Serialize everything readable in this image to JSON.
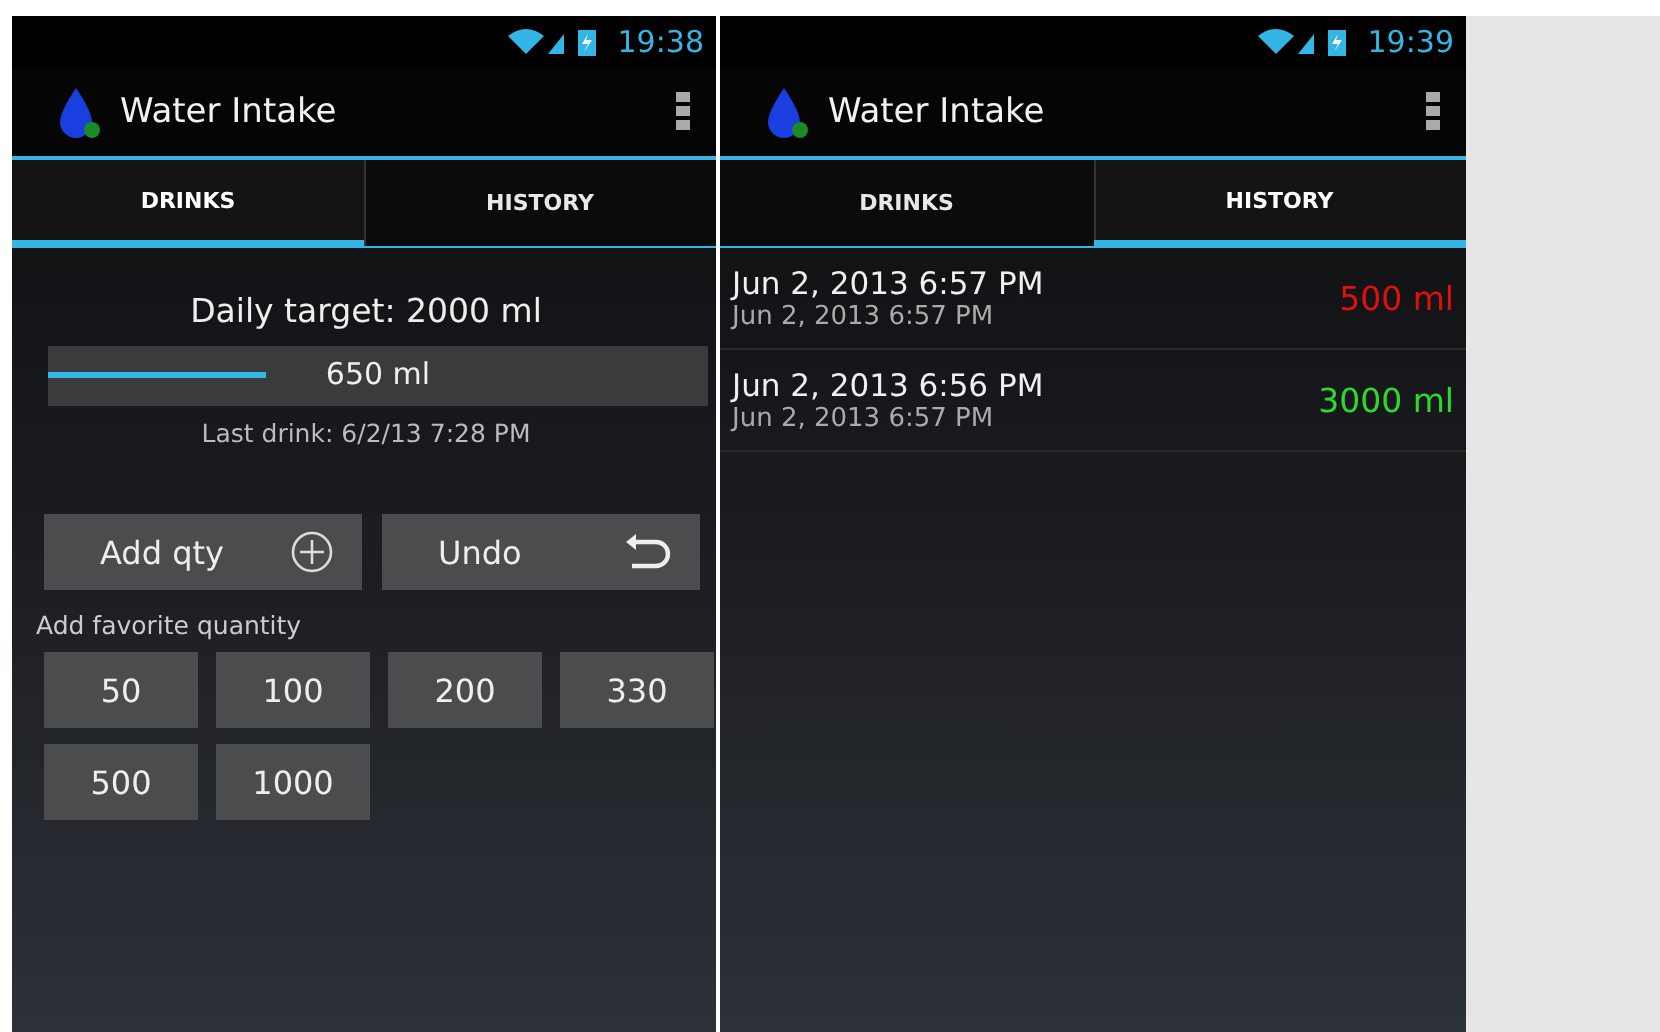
{
  "screens": [
    {
      "kind": "drinks",
      "time": "19:38",
      "app_title": "Water Intake",
      "tabs": [
        {
          "label": "DRINKS",
          "selected": true
        },
        {
          "label": "HISTORY",
          "selected": false
        }
      ],
      "daily_target": "Daily target: 2000 ml",
      "progress": {
        "level": 0.33,
        "reading": "650 ml"
      },
      "last_drink": "Last drink: 6/2/13 7:28 PM",
      "actions": [
        {
          "label": "Add qty",
          "kind": "add"
        },
        {
          "label": "Undo",
          "kind": "undo"
        }
      ],
      "favorites_label": "Add favorite quantity",
      "favorites": [
        "50",
        "100",
        "200",
        "330",
        "500",
        "1000"
      ]
    },
    {
      "kind": "history",
      "time": "19:39",
      "app_title": "Water Intake",
      "tabs": [
        {
          "label": "DRINKS",
          "selected": false
        },
        {
          "label": "HISTORY",
          "selected": true
        }
      ],
      "entries": [
        {
          "date": "Jun 2, 2013 6:57 PM",
          "sub_date": "Jun 2, 2013 6:57 PM",
          "amount": "500 ml",
          "color": "#e01010"
        },
        {
          "date": "Jun 2, 2013 6:56 PM",
          "sub_date": "Jun 2, 2013 6:57 PM",
          "amount": "3000 ml",
          "color": "#2ed82e"
        }
      ]
    }
  ]
}
